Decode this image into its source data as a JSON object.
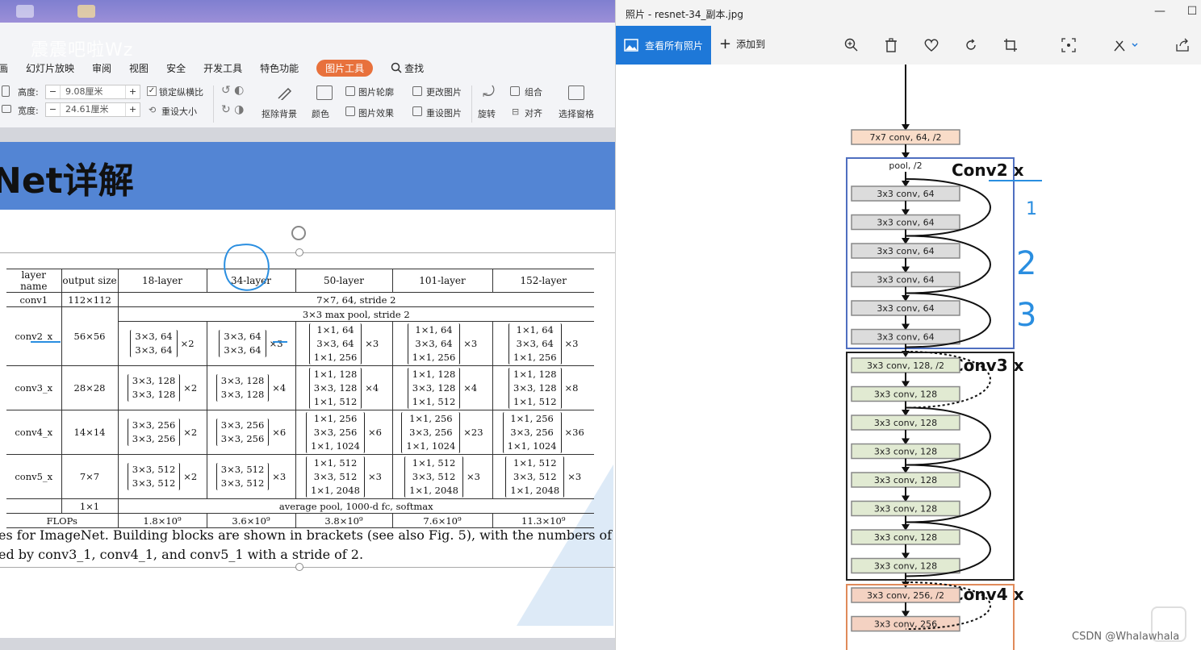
{
  "editor": {
    "watermark": "震震吧啦Wz",
    "menu_tabs": [
      "画",
      "幻灯片放映",
      "审阅",
      "视图",
      "安全",
      "开发工具",
      "特色功能",
      "图片工具",
      "查找"
    ],
    "active_tab": "图片工具",
    "ribbon": {
      "height_label": "高度:",
      "height_value": "9.08厘米",
      "width_label": "宽度:",
      "width_value": "24.61厘米",
      "lock_ratio": "锁定纵横比",
      "reset_size": "重设大小",
      "remove_bg": "抠除背景",
      "color": "颜色",
      "outline": "图片轮廓",
      "effect": "图片效果",
      "change_pic": "更改图片",
      "reset_pic": "重设图片",
      "rotate": "旋转",
      "group": "组合",
      "align": "对齐",
      "selection_pane": "选择窗格"
    },
    "slide_title": "Net详解",
    "table": {
      "headers": [
        "layer name",
        "output size",
        "18-layer",
        "34-layer",
        "50-layer",
        "101-layer",
        "152-layer"
      ],
      "conv1": {
        "name": "conv1",
        "size": "112×112",
        "desc": "7×7, 64, stride 2"
      },
      "maxpool": "3×3 max pool, stride 2",
      "conv2": {
        "name": "conv2_x",
        "size": "56×56",
        "c18": [
          "3×3, 64",
          "3×3, 64"
        ],
        "m18": "×2",
        "c34": [
          "3×3, 64",
          "3×3, 64"
        ],
        "m34": "×3",
        "c50": [
          "1×1, 64",
          "3×3, 64",
          "1×1, 256"
        ],
        "m50": "×3",
        "c101": [
          "1×1, 64",
          "3×3, 64",
          "1×1, 256"
        ],
        "m101": "×3",
        "c152": [
          "1×1, 64",
          "3×3, 64",
          "1×1, 256"
        ],
        "m152": "×3"
      },
      "conv3": {
        "name": "conv3_x",
        "size": "28×28",
        "c18": [
          "3×3, 128",
          "3×3, 128"
        ],
        "m18": "×2",
        "c34": [
          "3×3, 128",
          "3×3, 128"
        ],
        "m34": "×4",
        "c50": [
          "1×1, 128",
          "3×3, 128",
          "1×1, 512"
        ],
        "m50": "×4",
        "c101": [
          "1×1, 128",
          "3×3, 128",
          "1×1, 512"
        ],
        "m101": "×4",
        "c152": [
          "1×1, 128",
          "3×3, 128",
          "1×1, 512"
        ],
        "m152": "×8"
      },
      "conv4": {
        "name": "conv4_x",
        "size": "14×14",
        "c18": [
          "3×3, 256",
          "3×3, 256"
        ],
        "m18": "×2",
        "c34": [
          "3×3, 256",
          "3×3, 256"
        ],
        "m34": "×6",
        "c50": [
          "1×1, 256",
          "3×3, 256",
          "1×1, 1024"
        ],
        "m50": "×6",
        "c101": [
          "1×1, 256",
          "3×3, 256",
          "1×1, 1024"
        ],
        "m101": "×23",
        "c152": [
          "1×1, 256",
          "3×3, 256",
          "1×1, 1024"
        ],
        "m152": "×36"
      },
      "conv5": {
        "name": "conv5_x",
        "size": "7×7",
        "c18": [
          "3×3, 512",
          "3×3, 512"
        ],
        "m18": "×2",
        "c34": [
          "3×3, 512",
          "3×3, 512"
        ],
        "m34": "×3",
        "c50": [
          "1×1, 512",
          "3×3, 512",
          "1×1, 2048"
        ],
        "m50": "×3",
        "c101": [
          "1×1, 512",
          "3×3, 512",
          "1×1, 2048"
        ],
        "m101": "×3",
        "c152": [
          "1×1, 512",
          "3×3, 512",
          "1×1, 2048"
        ],
        "m152": "×3"
      },
      "pool": {
        "size": "1×1",
        "desc": "average pool, 1000-d fc, softmax"
      },
      "flops": {
        "label": "FLOPs",
        "values": [
          "1.8×10⁹",
          "3.6×10⁹",
          "3.8×10⁹",
          "7.6×10⁹",
          "11.3×10⁹"
        ]
      }
    },
    "caption": [
      "es for ImageNet. Building blocks are shown in brackets (see also Fig. 5), with the numbers of block",
      "ed by conv3_1, conv4_1, and conv5_1 with a stride of 2."
    ]
  },
  "photos": {
    "title": "照片 - resnet-34_副本.jpg",
    "all_photos": "查看所有照片",
    "add_to": "添加到",
    "icons": [
      "zoom-in-icon",
      "delete-icon",
      "heart-icon",
      "rotate-icon",
      "crop-icon",
      "enhance-icon",
      "edit-icon",
      "share-icon"
    ],
    "diagram": {
      "top": "7x7 conv, 64, /2",
      "pool": "pool, /2",
      "conv2_label": "Conv2 x",
      "conv3_label": "Conv3 x",
      "conv4_label": "Conv4 x",
      "conv2_boxes": [
        "3x3 conv, 64",
        "3x3 conv, 64",
        "3x3 conv, 64",
        "3x3 conv, 64",
        "3x3 conv, 64",
        "3x3 conv, 64"
      ],
      "conv3_boxes": [
        "3x3 conv, 128, /2",
        "3x3 conv, 128",
        "3x3 conv, 128",
        "3x3 conv, 128",
        "3x3 conv, 128",
        "3x3 conv, 128",
        "3x3 conv, 128",
        "3x3 conv, 128"
      ],
      "conv4_boxes": [
        "3x3 conv, 256, /2",
        "3x3 conv, 256"
      ],
      "annotations": [
        "1",
        "2",
        "3"
      ]
    },
    "colors": {
      "conv2": "#4f6fc0",
      "conv3": "#222222",
      "conv4": "#e08a5a",
      "box_conv1": "#f9dcc8",
      "box_conv2": "#dcdcdc",
      "box_conv3": "#e1ead2",
      "box_conv4": "#f4d2c2"
    }
  },
  "overlay": {
    "csdn": "CSDN @Whalawhala"
  }
}
